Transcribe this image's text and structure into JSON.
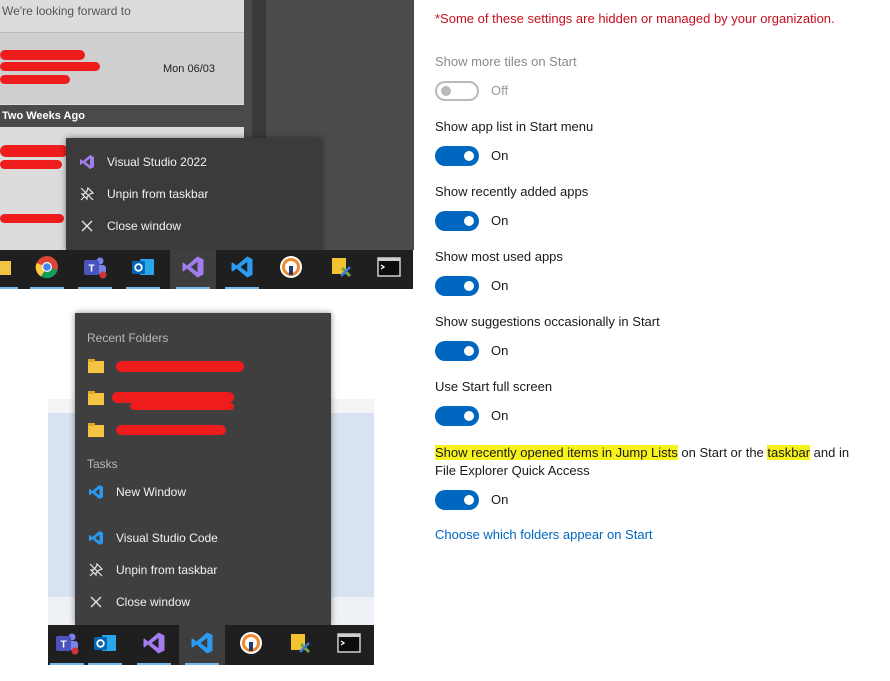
{
  "mail": {
    "top_preview": "We're looking forward to",
    "selected_item_date": "Mon 06/03",
    "group_header": "Two Weeks Ago"
  },
  "jumplist_vs": {
    "items": [
      {
        "label": "Visual Studio 2022",
        "icon": "visual-studio-icon"
      },
      {
        "label": "Unpin from taskbar",
        "icon": "unpin-icon"
      },
      {
        "label": "Close window",
        "icon": "close-icon"
      }
    ]
  },
  "taskbar_top": {
    "apps": [
      "folder-icon",
      "chrome-icon",
      "teams-icon",
      "outlook-icon",
      "visual-studio-icon",
      "vscode-icon",
      "vpn-icon",
      "tool-icon",
      "terminal-icon"
    ]
  },
  "jumplist_vscode": {
    "recent_header": "Recent Folders",
    "tasks_header": "Tasks",
    "task_new_window": "New Window",
    "items": [
      {
        "label": "Visual Studio Code",
        "icon": "vscode-icon"
      },
      {
        "label": "Unpin from taskbar",
        "icon": "unpin-icon"
      },
      {
        "label": "Close window",
        "icon": "close-icon"
      }
    ]
  },
  "taskbar_bottom": {
    "apps": [
      "teams-icon",
      "outlook-icon",
      "visual-studio-icon",
      "vscode-icon",
      "vpn-icon",
      "tool-icon",
      "terminal-icon"
    ]
  },
  "settings": {
    "managed_note": "*Some of these settings are hidden or managed by your organization.",
    "items": [
      {
        "label": "Show more tiles on Start",
        "state": "Off",
        "on": false,
        "disabled": true
      },
      {
        "label": "Show app list in Start menu",
        "state": "On",
        "on": true
      },
      {
        "label": "Show recently added apps",
        "state": "On",
        "on": true
      },
      {
        "label": "Show most used apps",
        "state": "On",
        "on": true
      },
      {
        "label": "Show suggestions occasionally in Start",
        "state": "On",
        "on": true
      },
      {
        "label": "Use Start full screen",
        "state": "On",
        "on": true
      }
    ],
    "jumplist_setting": {
      "part1": "Show recently opened items in Jump Lists",
      "part2": " on Start or the ",
      "part3": "taskbar",
      "part4": " and in",
      "line2": "File Explorer Quick Access",
      "state": "On"
    },
    "link": "Choose which folders appear on Start"
  },
  "colors": {
    "accent": "#0067c0",
    "warning": "#c50f1f",
    "highlight": "#f7f21b",
    "redaction": "#ee1c1c"
  }
}
